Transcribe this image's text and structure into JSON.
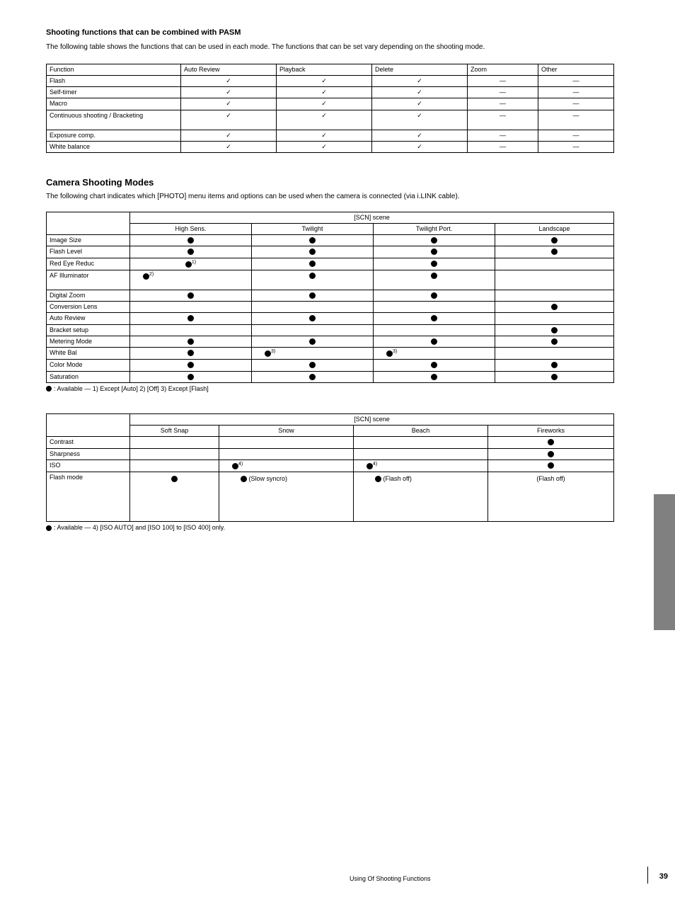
{
  "intro": {
    "title": "Shooting functions that can be combined with PASM",
    "text": "The following table shows the functions that can be used in each mode. The functions that can be set vary depending on the shooting mode."
  },
  "table1": {
    "headers": [
      "Function",
      "Auto Review",
      "Playback",
      "Delete",
      "Zoom",
      "Other"
    ],
    "rows": [
      [
        "Flash",
        "✓",
        "✓",
        "✓",
        "—",
        "—"
      ],
      [
        "Self-timer",
        "✓",
        "✓",
        "✓",
        "—",
        "—"
      ],
      [
        "Macro",
        "✓",
        "✓",
        "✓",
        "—",
        "—"
      ],
      [
        "Continuous shooting / Bracketing",
        "✓",
        "✓",
        "✓",
        "—",
        "—"
      ],
      [
        "Exposure comp.",
        "✓",
        "✓",
        "✓",
        "—",
        "—"
      ],
      [
        "White balance",
        "✓",
        "✓",
        "✓",
        "—",
        "—"
      ]
    ]
  },
  "section2": {
    "title": "Camera Shooting Modes",
    "subtitle": "The following chart indicates which [PHOTO] menu items and options can be used when the camera is connected (via i.LINK cable)."
  },
  "table2": {
    "groupHeader": "[SCN] scene",
    "cols": [
      "High Sens.",
      "Twilight",
      "Twilight Port.",
      "Landscape"
    ],
    "rows": [
      {
        "label": "Image Size",
        "cells": [
          "dot",
          "dot",
          "dot",
          "dot"
        ]
      },
      {
        "label": "Flash Level",
        "cells": [
          "dot",
          "dot",
          "dot",
          "dot"
        ]
      },
      {
        "label": "Red Eye Reduc",
        "cells": [
          "dot_sup:1)",
          "dot",
          "dot",
          ""
        ]
      },
      {
        "label": "AF Illuminator",
        "cells": [
          "dot_sup_left:2)",
          "dot",
          "dot",
          ""
        ]
      },
      {
        "label": "Digital Zoom",
        "cells": [
          "dot",
          "dot",
          "dot",
          ""
        ]
      },
      {
        "label": "Conversion Lens",
        "cells": [
          "",
          "",
          "",
          "dot"
        ]
      },
      {
        "label": "Auto Review",
        "cells": [
          "dot",
          "dot",
          "dot",
          ""
        ]
      },
      {
        "label": "Bracket setup",
        "cells": [
          "",
          "",
          "",
          "dot"
        ]
      },
      {
        "label": "Metering Mode",
        "cells": [
          "dot",
          "dot",
          "dot",
          "dot"
        ]
      },
      {
        "label": "White Bal",
        "cells": [
          "dot",
          "dot_sup_left:3)",
          "dot_sup_left:3)",
          ""
        ]
      },
      {
        "label": "Color Mode",
        "cells": [
          "dot",
          "dot",
          "dot",
          "dot"
        ]
      },
      {
        "label": "Saturation",
        "cells": [
          "dot",
          "dot",
          "dot",
          "dot"
        ]
      }
    ],
    "footnote": ": Available — 1) Except [Auto] 2) [Off] 3) Except [Flash]"
  },
  "table3": {
    "groupHeader": "[SCN] scene",
    "cols": [
      "Soft Snap",
      "Snow",
      "Beach",
      "Fireworks"
    ],
    "rows": [
      {
        "label": "Contrast",
        "cells": [
          "",
          "",
          "",
          "dot"
        ]
      },
      {
        "label": "Sharpness",
        "cells": [
          "",
          "",
          "",
          "dot"
        ]
      },
      {
        "label": "ISO",
        "cells": [
          "",
          "dot_sup_left:4)",
          "dot_sup_left:4)",
          "dot"
        ]
      },
      {
        "label": "Flash mode",
        "cells": [
          "dot",
          "dot_after:(Slow syncro)",
          "dot_after:(Flash off)",
          "text:(Flash off)"
        ]
      }
    ],
    "footnote": ": Available — 4) [ISO AUTO] and [ISO 100] to [ISO 400] only."
  },
  "footer": {
    "text": "Using Of Shooting Functions",
    "page": "39"
  }
}
